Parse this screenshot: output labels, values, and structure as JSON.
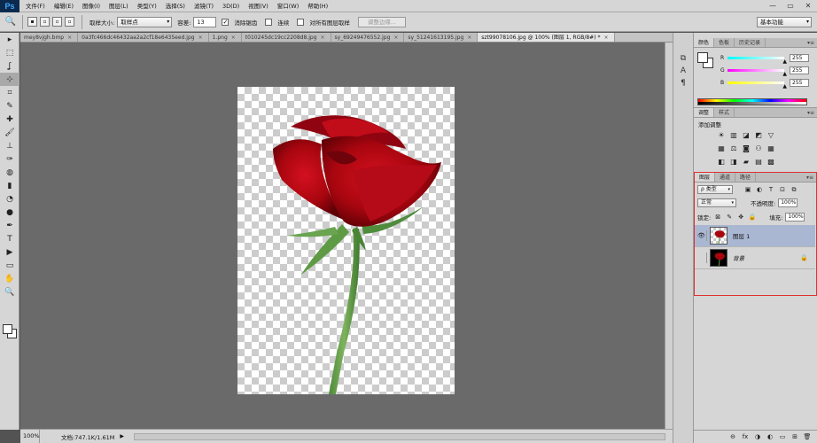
{
  "app": {
    "logo": "Ps",
    "menu": [
      "文件(F)",
      "编辑(E)",
      "图像(I)",
      "图层(L)",
      "类型(Y)",
      "选择(S)",
      "滤镜(T)",
      "3D(D)",
      "视图(V)",
      "窗口(W)",
      "帮助(H)"
    ],
    "window_controls": [
      "—",
      "▭",
      "✕"
    ]
  },
  "options": {
    "sample_size_label": "取样大小:",
    "sample_size_value": "取样点",
    "tolerance_label": "容差:",
    "tolerance_value": "13",
    "antialias_label": "消除锯齿",
    "antialias_checked": "✓",
    "contiguous_label": "连续",
    "all_layers_label": "对所有图层取样",
    "refine_edge_label": "调整边缘...",
    "workspace": "基本功能"
  },
  "tabs": [
    {
      "label": "mey8vjgh.bmp",
      "close": "×"
    },
    {
      "label": "0a3fc466dc46432aa2a2cf18e6435eed.jpg",
      "close": "×"
    },
    {
      "label": "1.png",
      "close": "×"
    },
    {
      "label": "t010245dc19cc2208d8.jpg",
      "close": "×"
    },
    {
      "label": "sy_69249476552.jpg",
      "close": "×"
    },
    {
      "label": "sy_51241613195.jpg",
      "close": "×"
    },
    {
      "label": "szt99078106.jpg @ 100% (图层 1, RGB/8#) *",
      "close": "×"
    }
  ],
  "status": {
    "zoom": "100%",
    "doc_info": "文档:747.1K/1.61M",
    "arrow": "▶"
  },
  "color_panel": {
    "tabs": [
      "颜色",
      "色板",
      "历史记录"
    ],
    "menu": "▾≡",
    "r_label": "R",
    "r_value": "255",
    "g_label": "G",
    "g_value": "255",
    "b_label": "B",
    "b_value": "255",
    "thumb": "▲"
  },
  "adjust_panel": {
    "tabs": [
      "调整",
      "样式"
    ],
    "menu": "▾≡",
    "title": "添加调整",
    "row1": [
      "☀",
      "▥",
      "◪",
      "◩",
      "▽"
    ],
    "row2": [
      "▦",
      "⚖",
      "◙",
      "⚇",
      "▦"
    ],
    "row3": [
      "◧",
      "◨",
      "▰",
      "▤",
      "▩"
    ]
  },
  "layers_panel": {
    "tabs": [
      "图层",
      "通道",
      "路径"
    ],
    "menu": "▾≡",
    "filter_value": "ρ 类型",
    "filter_icons": [
      "▣",
      "◐",
      "T",
      "⊡",
      "⧉"
    ],
    "blend_mode": "正常",
    "opacity_label": "不透明度:",
    "opacity_value": "100%",
    "lock_label": "锁定:",
    "lock_icons": [
      "⊠",
      "✎",
      "✥",
      "🔒"
    ],
    "fill_label": "填充:",
    "fill_value": "100%",
    "layers": [
      {
        "name": "图层 1",
        "eye": "👁"
      },
      {
        "name": "背景",
        "eye": "",
        "lock": "🔒"
      }
    ],
    "footer_icons": [
      "⊖",
      "fx",
      "◑",
      "◐",
      "▭",
      "⊞",
      "🗑"
    ]
  },
  "toolbar": {
    "tools": [
      "▸",
      "⬚",
      "ʆ",
      "⊹",
      "⌗",
      "✎",
      "✚",
      "🖌",
      "⊥",
      "✑",
      "◍",
      "▮",
      "◔",
      "●",
      "✒",
      "T",
      "▶",
      "▭",
      "✋",
      "🔍"
    ]
  },
  "dock": {
    "icons": [
      "⧉",
      "A",
      "¶"
    ]
  }
}
